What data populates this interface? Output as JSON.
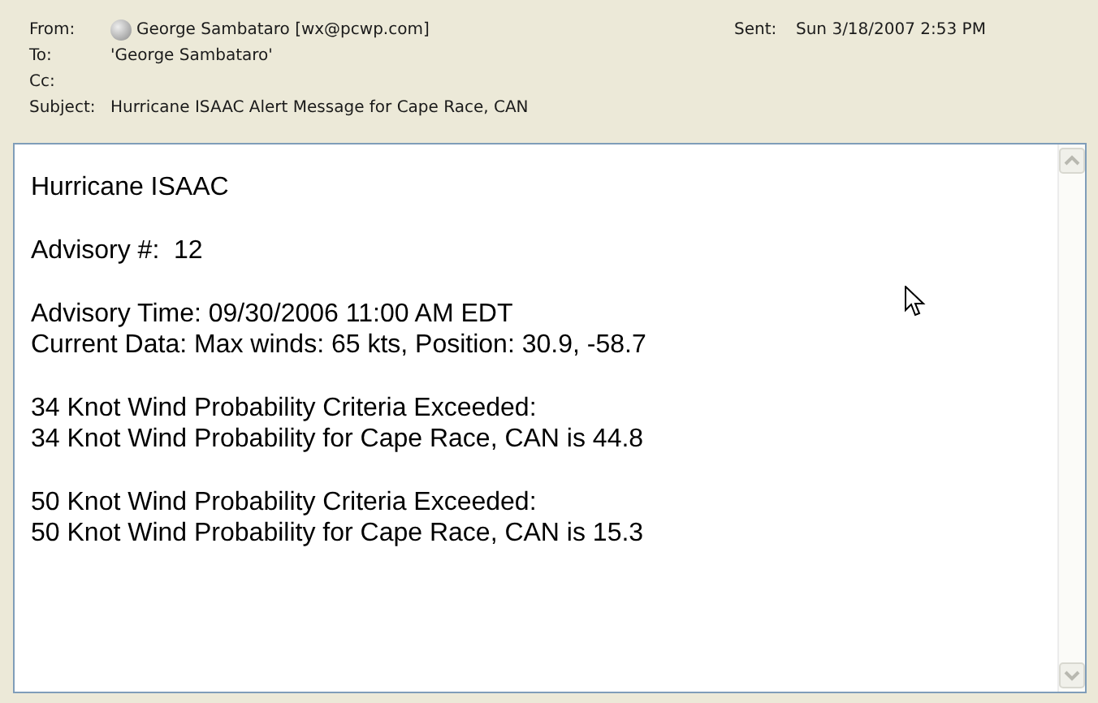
{
  "header": {
    "from": {
      "label": "From:",
      "value": "George Sambataro [wx@pcwp.com]"
    },
    "sent": {
      "label": "Sent:",
      "value": "Sun 3/18/2007 2:53 PM"
    },
    "rows": [
      {
        "label": "To:",
        "value": "'George Sambataro'"
      },
      {
        "label": "Cc:"
      },
      {
        "label": "Subject:",
        "value": "Hurricane ISAAC Alert Message for Cape Race, CAN"
      }
    ]
  },
  "body": {
    "paragraphs": [
      [
        "Hurricane ISAAC"
      ],
      [
        "Advisory #:  12"
      ],
      [
        "Advisory Time: 09/30/2006 11:00 AM EDT",
        "Current Data: Max winds: 65 kts, Position: 30.9, -58.7"
      ],
      [
        "34 Knot Wind Probability Criteria Exceeded:",
        "34 Knot Wind Probability for Cape Race, CAN is 44.8"
      ],
      [
        "50 Knot Wind Probability Criteria Exceeded:",
        "50 Knot Wind Probability for Cape Race, CAN is 15.3"
      ]
    ]
  }
}
